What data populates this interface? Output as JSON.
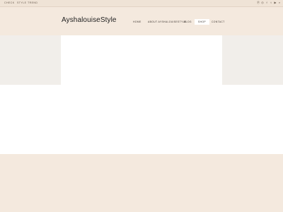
{
  "topbar": {
    "links": [
      {
        "label": "Check"
      },
      {
        "label": "Style"
      },
      {
        "label": "Trend"
      }
    ],
    "social_icons": [
      "pinterest-icon",
      "instagram-icon",
      "facebook-icon",
      "twitter-icon",
      "youtube-icon",
      "search-icon"
    ],
    "social_glyphs": [
      "Ⓟ",
      "◎",
      "f",
      "t",
      "▶",
      "⌕"
    ]
  },
  "header": {
    "logo": "AyshalouiseStyle"
  },
  "nav": {
    "items": [
      {
        "label": "Home"
      },
      {
        "label": "About AyshalouiseStyle"
      },
      {
        "label": "Blog"
      },
      {
        "label": "Shop",
        "active": true
      },
      {
        "label": "Contact"
      }
    ]
  },
  "colors": {
    "page_background": "#f4e9de",
    "content_background": "#ffffff",
    "banner_band": "#f5f1ec",
    "text": "#222222"
  }
}
